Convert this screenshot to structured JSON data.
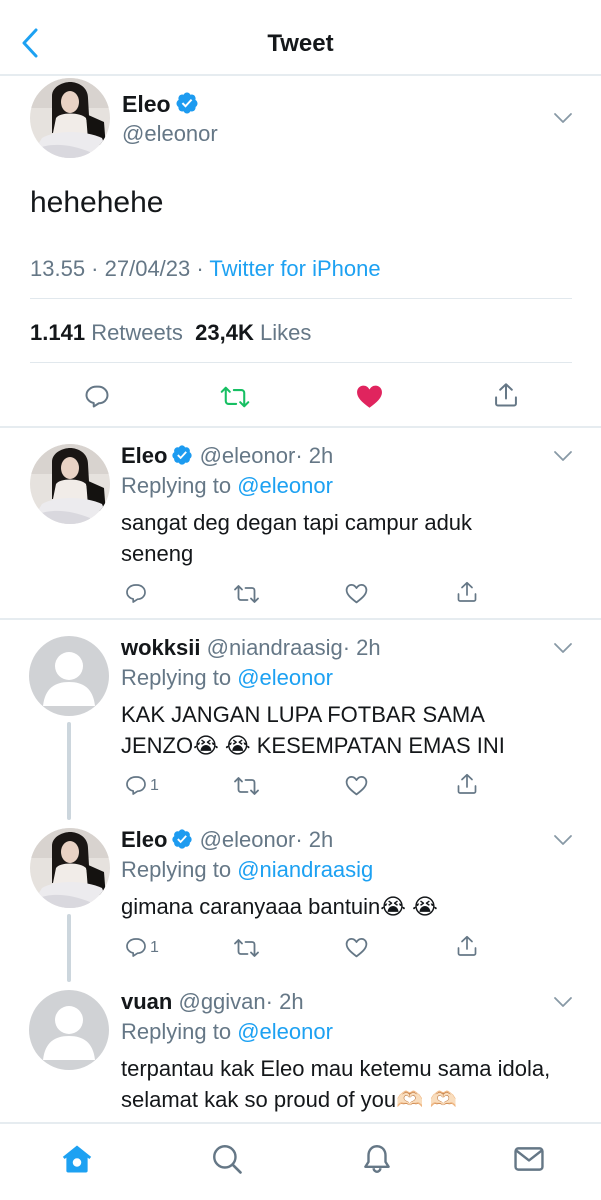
{
  "header": {
    "title": "Tweet",
    "back_icon": "chevron-left-icon"
  },
  "main_tweet": {
    "name": "Eleo",
    "handle": "@eleonor",
    "text": "hehehehe",
    "time": "13.55",
    "date": "27/04/23",
    "source": "Twitter for iPhone",
    "retweets": "1.141",
    "retweets_label": "Retweets",
    "likes": "23,4K",
    "likes_label": "Likes",
    "liked": true
  },
  "replies": [
    {
      "name": "Eleo",
      "handle": "@eleonor",
      "age": "· 2h",
      "replying_label": "Replying to",
      "replying_to": "@eleonor",
      "text": "sangat deg degan tapi campur aduk seneng",
      "reply_count": "",
      "verified": true
    },
    {
      "name": "wokksii",
      "handle": "@niandraasig",
      "age": "· 2h",
      "replying_label": "Replying to",
      "replying_to": "@eleonor",
      "text": "KAK JANGAN LUPA FOTBAR SAMA JENZO😭 😭  KESEMPATAN EMAS INI",
      "reply_count": "1",
      "verified": false
    },
    {
      "name": "Eleo",
      "handle": "@eleonor",
      "age": "· 2h",
      "replying_label": "Replying to",
      "replying_to": "@niandraasig",
      "text": "gimana caranyaaa bantuin😭 😭",
      "reply_count": "1",
      "verified": true
    },
    {
      "name": "vuan",
      "handle": "@ggivan",
      "age": "· 2h",
      "replying_label": "Replying to",
      "replying_to": "@eleonor",
      "text": "terpantau kak Eleo mau ketemu sama idola, selamat kak so proud of you🫶🏻 🫶🏻",
      "reply_count": "",
      "verified": false
    }
  ],
  "tab_bar": {
    "items": [
      "home-icon",
      "search-icon",
      "notifications-bell-icon",
      "messages-envelope-icon"
    ],
    "active": "home-icon"
  },
  "colors": {
    "accent": "#1da1f2",
    "verified": "#1d9bf0",
    "retweet_green": "#17bf63",
    "like_red": "#e0245e",
    "secondary_text": "#657786"
  }
}
